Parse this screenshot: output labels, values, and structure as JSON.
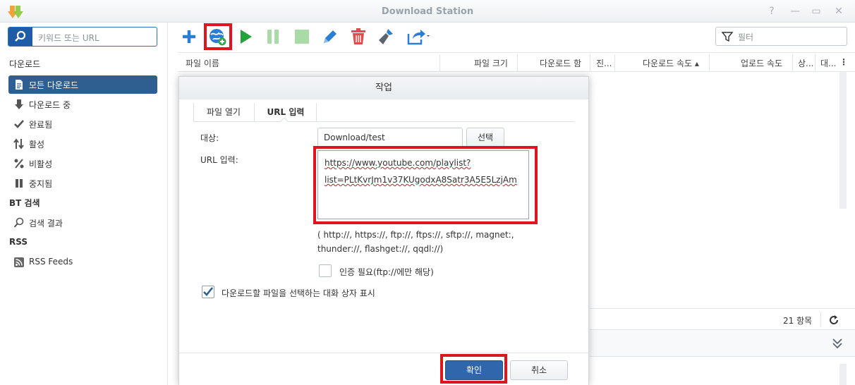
{
  "window": {
    "title": "Download Station",
    "controls": [
      "help-icon",
      "minimize-icon",
      "maximize-icon",
      "close-icon"
    ],
    "help_glyph": "?",
    "min_glyph": "—",
    "max_glyph": "▭",
    "close_glyph": "✕"
  },
  "sidebar": {
    "search_placeholder": "키워드 또는 URL",
    "section_download": "다운로드",
    "items": [
      {
        "label": "모든 다운로드",
        "icon": "file-icon",
        "active": true
      },
      {
        "label": "다운로드 중",
        "icon": "download-arrow-icon"
      },
      {
        "label": "완료됨",
        "icon": "checkmark-icon"
      },
      {
        "label": "활성",
        "icon": "updown-arrows-icon"
      },
      {
        "label": "비활성",
        "icon": "percent-icon"
      },
      {
        "label": "중지됨",
        "icon": "pause-icon"
      }
    ],
    "section_bt": "BT 검색",
    "bt_items": [
      {
        "label": "검색 결과",
        "icon": "search-icon"
      }
    ],
    "section_rss": "RSS",
    "rss_items": [
      {
        "label": "RSS Feeds",
        "icon": "rss-icon"
      }
    ]
  },
  "toolbar": {
    "icons": [
      "add-icon",
      "add-url-icon",
      "resume-icon",
      "pause-icon",
      "stop-icon",
      "edit-icon",
      "delete-icon",
      "clear-icon",
      "share-icon"
    ],
    "filter_placeholder": "필터"
  },
  "table": {
    "columns": [
      "파일 이름",
      "파일 크기",
      "다운로드 함",
      "진...",
      "다운로드 속도 ▴",
      "업로드 속도",
      "상...",
      "대..."
    ],
    "count_label": "21 항목"
  },
  "dialog": {
    "title": "작업",
    "tabs": [
      "파일 열기",
      "URL 입력"
    ],
    "dest_label": "대상:",
    "dest_value": "Download/test",
    "select_button": "선택",
    "url_label": "URL 입력:",
    "url_line1": "https://www.youtube.com/playlist?",
    "url_line2": "list=PLtKvrJm1v37KUgodxA8Satr3A5E5LzjAm",
    "protocol_hint": "( http://, https://, ftp://, ftps://, sftp://, magnet:, thunder://, flashget://, qqdl://)",
    "auth_label": "인증 필요(ftp://에만 해당)",
    "auth_checked": false,
    "show_dialog_label": "다운로드할 파일을 선택하는 대화 상자 표시",
    "show_dialog_checked": true,
    "ok_button": "확인",
    "cancel_button": "취소"
  },
  "colors": {
    "accent": "#2f5e91",
    "highlight": "#e0141e",
    "play": "#23a33a",
    "delete": "#e04b4b"
  }
}
